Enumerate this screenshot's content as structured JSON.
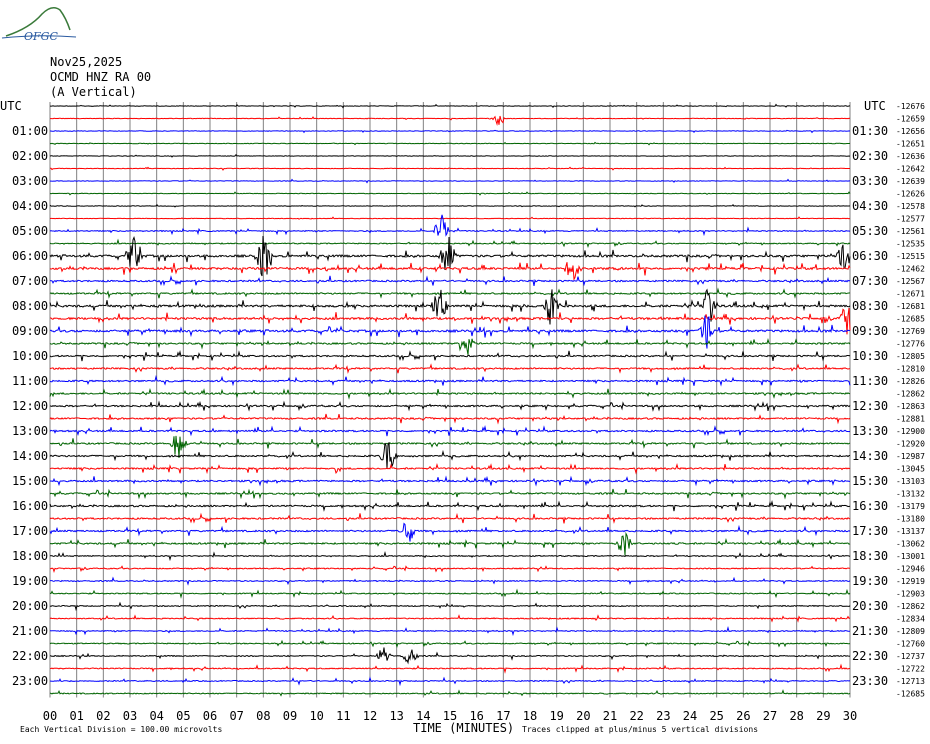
{
  "header": {
    "logo_text": "OFGC",
    "date": "Nov25,2025",
    "station": "OCMD HNZ RA 00",
    "component": "(A Vertical)"
  },
  "footer": {
    "scale_note": "Each Vertical Division =  100.00 microvolts",
    "xlabel": "TIME (MINUTES)",
    "clip_note": "Traces clipped at plus/minus 5 vertical divisions"
  },
  "colors": {
    "black": "#000000",
    "red": "#ff0000",
    "blue": "#0000ff",
    "green": "#006400",
    "grid": "#808080"
  },
  "chart_data": {
    "type": "line",
    "title": "",
    "xlabel": "TIME (MINUTES)",
    "xlim": [
      0,
      30
    ],
    "x_ticks": [
      "00",
      "01",
      "02",
      "03",
      "04",
      "05",
      "06",
      "07",
      "08",
      "09",
      "10",
      "11",
      "12",
      "13",
      "14",
      "15",
      "16",
      "17",
      "18",
      "19",
      "20",
      "21",
      "22",
      "23",
      "24",
      "25",
      "26",
      "27",
      "28",
      "29",
      "30"
    ],
    "left_corner_label": "UTC",
    "right_corner_label": "UTC",
    "left_hour_labels": [
      "01:00",
      "02:00",
      "03:00",
      "04:00",
      "05:00",
      "06:00",
      "07:00",
      "08:00",
      "09:00",
      "10:00",
      "11:00",
      "12:00",
      "13:00",
      "14:00",
      "15:00",
      "16:00",
      "17:00",
      "18:00",
      "19:00",
      "20:00",
      "21:00",
      "22:00",
      "23:00"
    ],
    "right_hour_labels": [
      "01:30",
      "02:30",
      "03:30",
      "04:30",
      "05:30",
      "06:30",
      "07:30",
      "08:30",
      "09:30",
      "10:30",
      "11:30",
      "12:30",
      "13:30",
      "14:30",
      "15:30",
      "16:30",
      "17:30",
      "18:30",
      "19:30",
      "20:30",
      "21:30",
      "22:30",
      "23:30"
    ],
    "trace_counts": [
      "-12676",
      "-12659",
      "-12656",
      "-12651",
      "-12636",
      "-12642",
      "-12639",
      "-12626",
      "-12578",
      "-12577",
      "-12561",
      "-12535",
      "-12515",
      "-12462",
      "-12567",
      "-12671",
      "-12681",
      "-12685",
      "-12769",
      "-12776",
      "-12805",
      "-12810",
      "-12826",
      "-12862",
      "-12863",
      "-12881",
      "-12900",
      "-12920",
      "-12987",
      "-13045",
      "-13103",
      "-13132",
      "-13179",
      "-13180",
      "-13137",
      "-13062",
      "-13001",
      "-12946",
      "-12919",
      "-12903",
      "-12862",
      "-12834",
      "-12809",
      "-12760",
      "-12737",
      "-12722",
      "-12713",
      "-12685"
    ],
    "trace_colors": [
      "black",
      "red",
      "blue",
      "green"
    ],
    "trace_activity": [
      1,
      1,
      1,
      1,
      1,
      1,
      1,
      1,
      1,
      1,
      2,
      2,
      4,
      4,
      3,
      3,
      4,
      4,
      4,
      3,
      3,
      3,
      3,
      3,
      3,
      3,
      3,
      3,
      3,
      3,
      3,
      3,
      3,
      3,
      3,
      3,
      2,
      2,
      2,
      2,
      2,
      2,
      2,
      2,
      2,
      2,
      2,
      2
    ],
    "events": [
      {
        "trace": 1,
        "minute": 16.8,
        "amp": 1.2
      },
      {
        "trace": 10,
        "minute": 14.7,
        "amp": 2.5
      },
      {
        "trace": 12,
        "minute": 3.2,
        "amp": 3
      },
      {
        "trace": 12,
        "minute": 8.0,
        "amp": 4
      },
      {
        "trace": 12,
        "minute": 14.9,
        "amp": 3.5
      },
      {
        "trace": 12,
        "minute": 29.8,
        "amp": 2.5
      },
      {
        "trace": 13,
        "minute": 19.6,
        "amp": 2
      },
      {
        "trace": 16,
        "minute": 14.6,
        "amp": 2.5
      },
      {
        "trace": 16,
        "minute": 18.8,
        "amp": 3.5
      },
      {
        "trace": 16,
        "minute": 24.7,
        "amp": 3
      },
      {
        "trace": 17,
        "minute": 29.9,
        "amp": 2.5
      },
      {
        "trace": 18,
        "minute": 24.6,
        "amp": 3
      },
      {
        "trace": 19,
        "minute": 15.6,
        "amp": 2.5
      },
      {
        "trace": 27,
        "minute": 4.8,
        "amp": 2.5
      },
      {
        "trace": 28,
        "minute": 12.7,
        "amp": 3
      },
      {
        "trace": 34,
        "minute": 13.4,
        "amp": 2
      },
      {
        "trace": 35,
        "minute": 21.5,
        "amp": 2
      },
      {
        "trace": 44,
        "minute": 12.5,
        "amp": 1.2
      },
      {
        "trace": 44,
        "minute": 13.5,
        "amp": 1.2
      }
    ]
  }
}
